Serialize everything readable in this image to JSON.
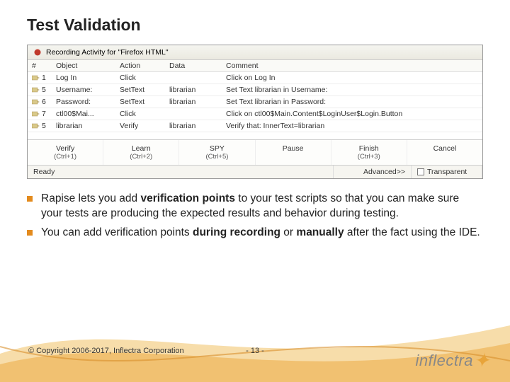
{
  "title": "Test Validation",
  "window": {
    "caption": "Recording Activity for \"Firefox HTML\""
  },
  "columns": {
    "num": "#",
    "object": "Object",
    "action": "Action",
    "data": "Data",
    "comment": "Comment"
  },
  "rows": [
    {
      "num": "1",
      "object": "Log In",
      "action": "Click",
      "data": "",
      "comment": "Click on Log In"
    },
    {
      "num": "5",
      "object": "Username:",
      "action": "SetText",
      "data": "librarian",
      "comment": "Set Text librarian in Username:"
    },
    {
      "num": "6",
      "object": "Password:",
      "action": "SetText",
      "data": "librarian",
      "comment": "Set Text librarian in Password:"
    },
    {
      "num": "7",
      "object": "ctl00$Mai...",
      "action": "Click",
      "data": "",
      "comment": "Click on ctl00$Main.Content$LoginUser$Login.Button"
    },
    {
      "num": "5",
      "object": "librarian",
      "action": "Verify",
      "data": "librarian",
      "comment": "Verify that: InnerText=librarian"
    }
  ],
  "buttons": {
    "verify": {
      "label": "Verify",
      "sub": "(Ctrl+1)"
    },
    "learn": {
      "label": "Learn",
      "sub": "(Ctrl+2)"
    },
    "spy": {
      "label": "SPY",
      "sub": "(Ctrl+5)"
    },
    "pause": {
      "label": "Pause",
      "sub": ""
    },
    "finish": {
      "label": "Finish",
      "sub": "(Ctrl+3)"
    },
    "cancel": {
      "label": "Cancel",
      "sub": ""
    }
  },
  "status": {
    "ready": "Ready",
    "advanced": "Advanced>>",
    "transparent": "Transparent"
  },
  "bullets": {
    "b1a": "Rapise lets you add ",
    "b1b": "verification points",
    "b1c": " to your test scripts so that you can make sure your tests are producing the expected results and behavior during testing.",
    "b2a": "You can add verification points ",
    "b2b": "during recording",
    "b2c": " or ",
    "b2d": "manually",
    "b2e": " after the fact using the IDE."
  },
  "footer": {
    "copyright": "© Copyright 2006-2017, Inflectra Corporation",
    "page": "- 13 -",
    "logo": "inflectra"
  }
}
